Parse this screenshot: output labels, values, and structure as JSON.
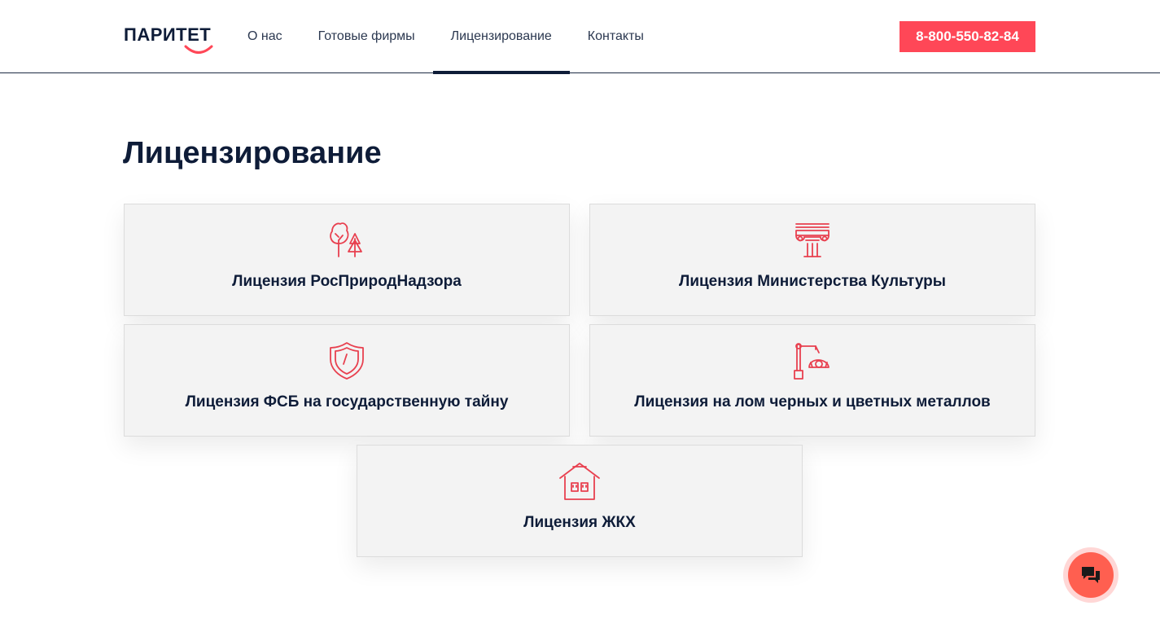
{
  "header": {
    "logo_text": "ПАРИТЕТ",
    "nav": [
      {
        "label": "О нас"
      },
      {
        "label": "Готовые фирмы"
      },
      {
        "label": "Лицензирование"
      },
      {
        "label": "Контакты"
      }
    ],
    "active_nav": "Лицензирование",
    "phone": "8-800-550-82-84"
  },
  "main": {
    "title": "Лицензирование",
    "cards": [
      {
        "label": "Лицензия РосПриродНадзора",
        "icon": "trees-icon"
      },
      {
        "label": "Лицензия Министерства Культуры",
        "icon": "column-capital-icon"
      },
      {
        "label": "Лицензия ФСБ на государственную тайну",
        "icon": "shield-icon"
      },
      {
        "label": "Лицензия на лом черных и цветных металлов",
        "icon": "scrap-crane-icon"
      },
      {
        "label": "Лицензия ЖКХ",
        "icon": "house-icon"
      }
    ]
  },
  "chat": {
    "icon": "chat-bubbles-icon"
  },
  "colors": {
    "accent": "#ff4757",
    "icon_red": "#e8404f",
    "dark": "#0e1c38",
    "card_bg": "#f3f3f3",
    "chat": "#ff5f50"
  }
}
